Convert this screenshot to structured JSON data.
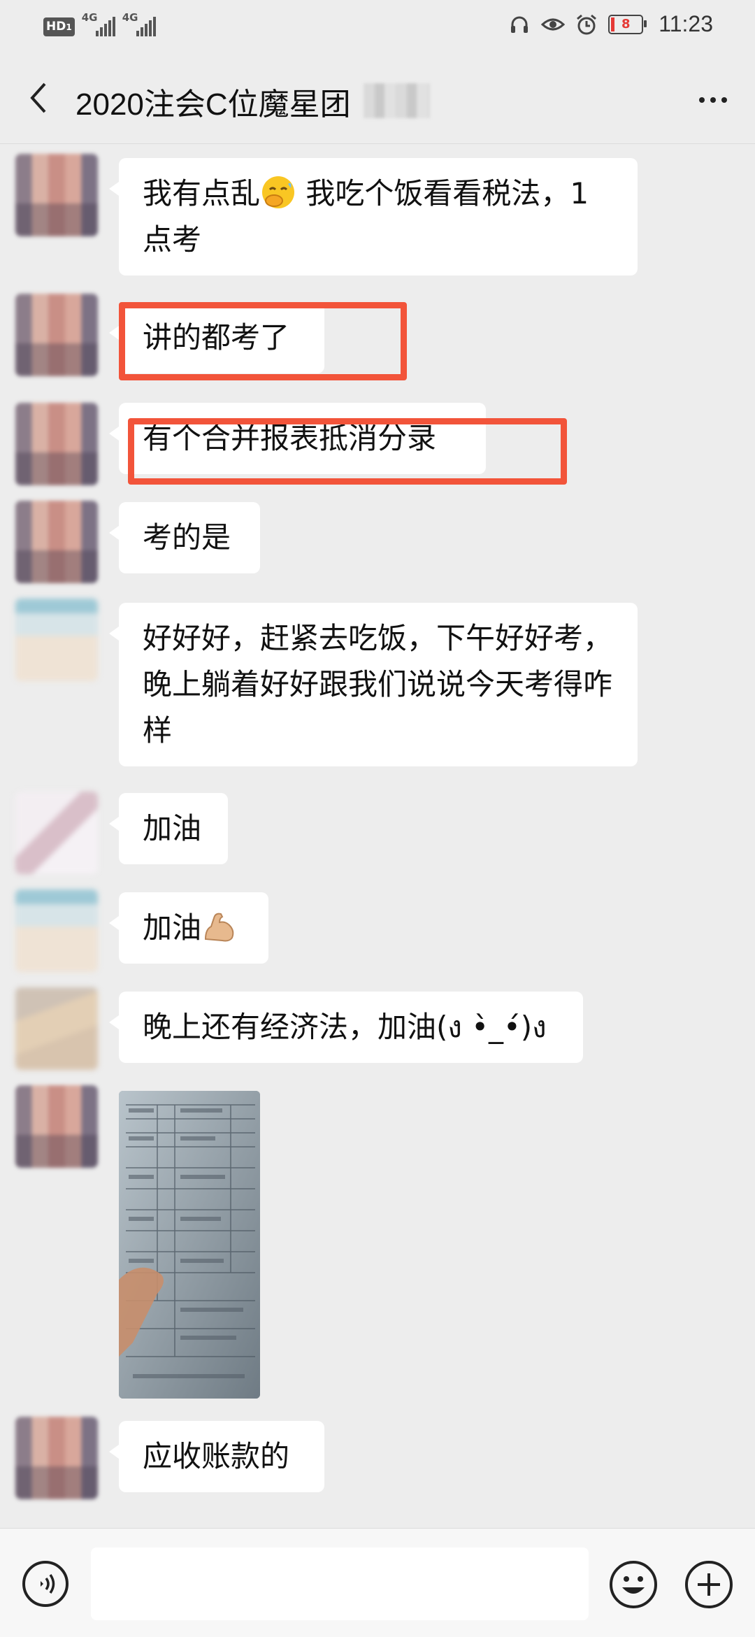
{
  "status_bar": {
    "left_badge": "HD",
    "left_badge_sub": "1",
    "signal1_label": "4G",
    "signal2_label": "4G",
    "battery_level": "8",
    "time": "11:23",
    "icons": [
      "headphones-icon",
      "eye-icon",
      "alarm-icon",
      "battery-icon"
    ]
  },
  "header": {
    "title": "2020注会C位魔星团",
    "back_icon": "chevron-left-icon",
    "more_icon": "more-dots-icon"
  },
  "messages": [
    {
      "type": "text",
      "text_before": "我有点乱",
      "emoji": "face-hand-over-mouth-emoji",
      "text_after": " 我吃个饭看看税法，1点考"
    },
    {
      "type": "text",
      "text": "讲的都考了",
      "highlighted": true
    },
    {
      "type": "text",
      "text": "有个合并报表抵消分录",
      "highlighted": true
    },
    {
      "type": "text",
      "text": "考的是"
    },
    {
      "type": "text",
      "text": "好好好，赶紧去吃饭，下午好好考，晚上躺着好好跟我们说说今天考得咋样"
    },
    {
      "type": "text",
      "text": "加油"
    },
    {
      "type": "text",
      "text": "加油",
      "emoji": "flexed-biceps-emoji"
    },
    {
      "type": "text",
      "text": "晚上还有经济法，加油(ง •̀_•́)ง"
    },
    {
      "type": "image",
      "description_icon": "photo-thumbnail"
    },
    {
      "type": "text",
      "text": "应收账款的"
    }
  ],
  "input_bar": {
    "voice_icon": "voice-icon",
    "emoji_icon": "smiley-icon",
    "plus_icon": "plus-icon",
    "value": ""
  },
  "colors": {
    "background": "#ededed",
    "bubble": "#ffffff",
    "highlight": "#f2543a",
    "battery_low": "#e53935"
  }
}
